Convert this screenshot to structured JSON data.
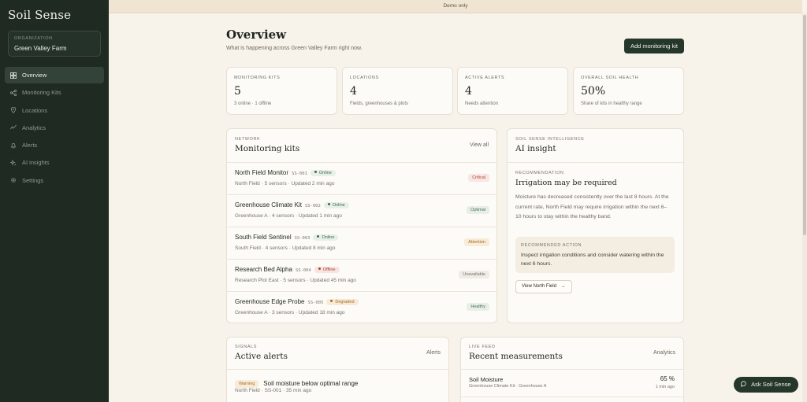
{
  "brand": "Soil Sense",
  "organization": {
    "label": "ORGANIZATION",
    "name": "Green Valley Farm"
  },
  "nav": [
    {
      "icon": "grid-icon",
      "label": "Overview",
      "active": true
    },
    {
      "icon": "network-icon",
      "label": "Monitoring Kits"
    },
    {
      "icon": "location-pin-icon",
      "label": "Locations"
    },
    {
      "icon": "analytics-icon",
      "label": "Analytics"
    },
    {
      "icon": "bell-icon",
      "label": "Alerts"
    },
    {
      "icon": "sparkle-icon",
      "label": "AI insights"
    },
    {
      "icon": "gear-icon",
      "label": "Settings"
    }
  ],
  "banner": "Demo only",
  "header": {
    "title": "Overview",
    "subtitle": "What is happening across Green Valley Farm right now.",
    "add_kit_label": "Add monitoring kit"
  },
  "stats": [
    {
      "label": "MONITORING KITS",
      "value": "5",
      "sub": "3 online · 1 offline"
    },
    {
      "label": "LOCATIONS",
      "value": "4",
      "sub": "Fields, greenhouses & plots"
    },
    {
      "label": "ACTIVE ALERTS",
      "value": "4",
      "sub": "Needs attention"
    },
    {
      "label": "OVERALL SOIL HEALTH",
      "value": "50%",
      "sub": "Share of kits in healthy range"
    }
  ],
  "kits_card": {
    "eyebrow": "NETWORK",
    "title": "Monitoring kits",
    "view_all": "View all",
    "kits": [
      {
        "name": "North Field Monitor",
        "id": "SS-001",
        "conn": "Online",
        "conn_kind": "online",
        "meta": "North Field · 5 sensors · Updated 2 min ago",
        "status": "Critical",
        "status_kind": "critical"
      },
      {
        "name": "Greenhouse Climate Kit",
        "id": "SS-002",
        "conn": "Online",
        "conn_kind": "online",
        "meta": "Greenhouse A · 4 sensors · Updated 1 min ago",
        "status": "Optimal",
        "status_kind": "optimal"
      },
      {
        "name": "South Field Sentinel",
        "id": "SS-003",
        "conn": "Online",
        "conn_kind": "online",
        "meta": "South Field · 4 sensors · Updated 8 min ago",
        "status": "Attention",
        "status_kind": "attention"
      },
      {
        "name": "Research Bed Alpha",
        "id": "SS-004",
        "conn": "Offline",
        "conn_kind": "offline",
        "meta": "Research Plot East · 5 sensors · Updated 45 min ago",
        "status": "Unavailable",
        "status_kind": "unavailable"
      },
      {
        "name": "Greenhouse Edge Probe",
        "id": "SS-005",
        "conn": "Degraded",
        "conn_kind": "degraded",
        "meta": "Greenhouse A · 3 sensors · Updated 18 min ago",
        "status": "Healthy",
        "status_kind": "healthy"
      }
    ]
  },
  "insight_card": {
    "eyebrow": "SOIL SENSE INTELLIGENCE",
    "title": "AI insight",
    "rec_label": "RECOMMENDATION",
    "rec_title": "Irrigation may be required",
    "rec_body": "Moisture has decreased consistently over the last 8 hours. At the current rate, North Field may require irrigation within the next 6–10 hours to stay within the healthy band.",
    "action_label": "RECOMMENDED ACTION",
    "action_text": "Inspect irrigation conditions and consider watering within the next 6 hours.",
    "view_button": "View North Field"
  },
  "alerts_card": {
    "eyebrow": "SIGNALS",
    "title": "Active alerts",
    "link": "Alerts",
    "first_alert": {
      "tag": "Warning",
      "title": "Soil moisture below optimal range",
      "meta": "North Field · SS-001 · 35 min ago"
    }
  },
  "measurements_card": {
    "eyebrow": "LIVE FEED",
    "title": "Recent measurements",
    "link": "Analytics",
    "first": {
      "name": "Soil Moisture",
      "sub": "Greenhouse Climate Kit · Greenhouse A",
      "value": "65 %",
      "time": "1 min ago"
    }
  },
  "ask_button": "Ask Soil Sense",
  "colors": {
    "sidebar_bg": "#1f2a23",
    "accent": "#25362b",
    "page_bg": "#f7f3ea"
  }
}
